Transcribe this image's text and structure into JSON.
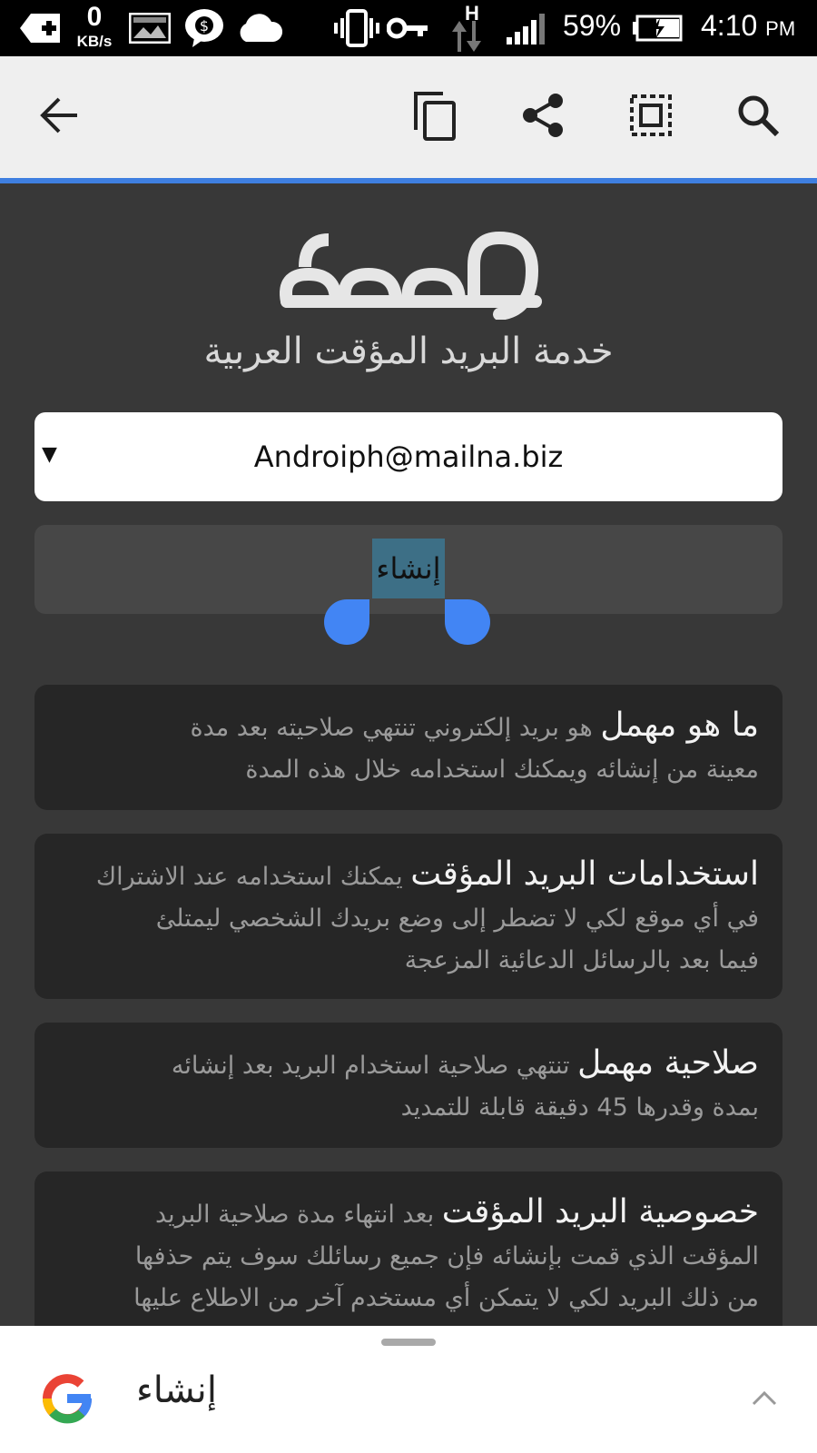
{
  "status_bar": {
    "net_speed_value": "0",
    "net_speed_unit": "KB/s",
    "network_type": "H",
    "battery_percent": "59%",
    "time": "4:10",
    "time_suffix": "PM",
    "icons": [
      "add-box-icon",
      "image-icon",
      "messenger-icon",
      "cloud-icon",
      "vibrate-icon",
      "vpn-key-icon",
      "data-arrows-icon",
      "signal-icon",
      "battery-charging-icon"
    ]
  },
  "toolbar": {
    "icons": [
      "back-arrow-icon",
      "copy-icon",
      "share-icon",
      "select-all-icon",
      "search-icon"
    ],
    "progress_color": "#3f7fe0"
  },
  "page": {
    "logo_text": "مهمل",
    "subtitle": "خدمة البريد المؤقت العربية",
    "email_value": "Androiph@mailna.biz",
    "dropdown_arrow": "▼",
    "create_button_label": "إنشاء",
    "selection_handle_color": "#4285f4"
  },
  "cards": [
    {
      "title": "ما هو مهمل",
      "line1": "هو بريد إلكتروني تنتهي صلاحيته بعد مدة",
      "line2": "معينة من إنشائه ويمكنك استخدامه خلال هذه المدة"
    },
    {
      "title": "استخدامات البريد المؤقت",
      "line1": "يمكنك استخدامه عند الاشتراك",
      "line2": "في أي موقع لكي لا تضطر إلى وضع بريدك الشخصي ليمتلئ",
      "line3": "فيما بعد بالرسائل الدعائية المزعجة"
    },
    {
      "title": "صلاحية مهمل",
      "line1": "تنتهي صلاحية استخدام البريد بعد إنشائه",
      "line2": "بمدة وقدرها 45 دقيقة قابلة للتمديد"
    },
    {
      "title": "خصوصية البريد المؤقت",
      "line1": "بعد انتهاء مدة صلاحية البريد",
      "line2": "المؤقت الذي قمت بإنشائه فإن جميع رسائلك سوف يتم حذفها",
      "line3": "من ذلك البريد لكي لا يتمكن أي مستخدم آخر من الاطلاع عليها"
    }
  ],
  "bottom_sheet": {
    "query": "إنشاء",
    "icons": [
      "google-g-icon",
      "chevron-up-icon"
    ]
  }
}
